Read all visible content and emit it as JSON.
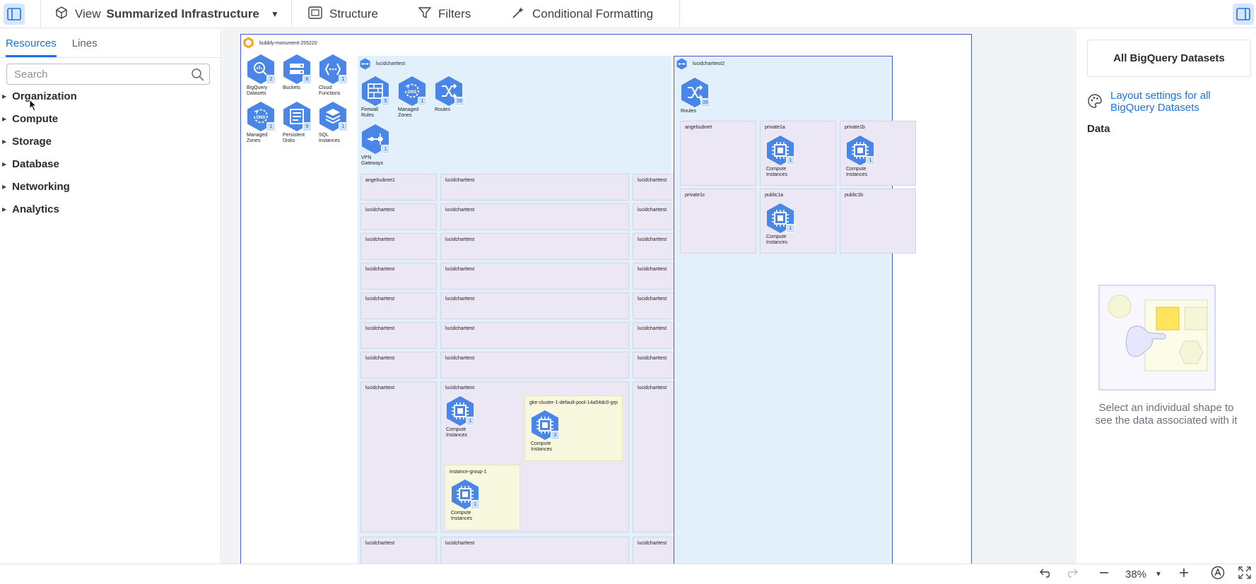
{
  "toolbar": {
    "view_label": "View",
    "view_name": "Summarized Infrastructure",
    "structure_label": "Structure",
    "filters_label": "Filters",
    "conditional_formatting_label": "Conditional Formatting"
  },
  "left_panel": {
    "tabs": [
      "Resources",
      "Lines"
    ],
    "search_placeholder": "Search",
    "categories": [
      "Organization",
      "Compute",
      "Storage",
      "Database",
      "Networking",
      "Analytics"
    ]
  },
  "diagram": {
    "project_name": "bubbly-monument-255220",
    "project_resources": [
      {
        "name": "BigQuery Datasets",
        "line1": "BigQuery",
        "line2": "Datasets",
        "count": "2",
        "icon": "bigquery-icon"
      },
      {
        "name": "Buckets",
        "line1": "Buckets",
        "line2": "",
        "count": "6",
        "icon": "bucket-icon"
      },
      {
        "name": "Cloud Functions",
        "line1": "Cloud",
        "line2": "Functions",
        "count": "1",
        "icon": "cloud-functions-icon"
      },
      {
        "name": "Managed Zones",
        "line1": "Managed",
        "line2": "Zones",
        "count": "1",
        "icon": "dns-icon"
      },
      {
        "name": "Persistent Disks",
        "line1": "Persistent",
        "line2": "Disks",
        "count": "9",
        "icon": "disk-icon"
      },
      {
        "name": "SQL Instances",
        "line1": "SQL",
        "line2": "Instances",
        "count": "1",
        "icon": "sql-icon"
      }
    ],
    "vpc1": {
      "name": "lucidcharttest",
      "resources": [
        {
          "name": "Firewall Rules",
          "line1": "Firewall",
          "line2": "Rules",
          "count": "5",
          "icon": "firewall-icon"
        },
        {
          "name": "Managed Zones",
          "line1": "Managed",
          "line2": "Zones",
          "count": "1",
          "icon": "dns-icon"
        },
        {
          "name": "Routes",
          "line1": "Routes",
          "line2": "",
          "count": "39",
          "icon": "routes-icon"
        },
        {
          "name": "VPN Gateways",
          "line1": "VPN",
          "line2": "Gateways",
          "count": "1",
          "icon": "vpn-icon"
        }
      ],
      "subnet_rows": [
        [
          "angelsubnet1",
          "lucidcharttest",
          "lucidcharttest"
        ],
        [
          "lucidcharttest",
          "lucidcharttest",
          "lucidcharttest"
        ],
        [
          "lucidcharttest",
          "lucidcharttest",
          "lucidcharttest"
        ],
        [
          "lucidcharttest",
          "lucidcharttest",
          "lucidcharttest"
        ],
        [
          "lucidcharttest",
          "lucidcharttest",
          "lucidcharttest"
        ],
        [
          "lucidcharttest",
          "lucidcharttest",
          "lucidcharttest"
        ],
        [
          "lucidcharttest",
          "lucidcharttest",
          "lucidcharttest"
        ],
        [
          "lucidcharttest",
          "lucidcharttest",
          "lucidcharttest"
        ],
        [
          "lucidcharttest",
          "lucidcharttest",
          "lucidcharttest"
        ]
      ],
      "compute_in_subnet": {
        "line1": "Compute",
        "line2": "Instances",
        "count": "1"
      },
      "gke_group": {
        "name": "gke-cluster-1-default-pool-14a54dc0-grp",
        "line1": "Compute",
        "line2": "Instances",
        "count": "3"
      },
      "instance_group": {
        "name": "instance-group-1",
        "line1": "Compute",
        "line2": "Instances",
        "count": "1"
      }
    },
    "vpc2": {
      "name": "lucidcharttest2",
      "routes": {
        "line1": "Routes",
        "line2": "",
        "count": "39"
      },
      "subnets": [
        {
          "name": "angelsubnet",
          "has_compute": false
        },
        {
          "name": "private1a",
          "has_compute": true
        },
        {
          "name": "private1b",
          "has_compute": true
        },
        {
          "name": "private1c",
          "has_compute": false
        },
        {
          "name": "public1a",
          "has_compute": true
        },
        {
          "name": "public1b",
          "has_compute": false
        }
      ],
      "compute": {
        "line1": "Compute",
        "line2": "Instances",
        "count": "1"
      }
    }
  },
  "right_panel": {
    "title": "All BigQuery Datasets",
    "layout_link": "Layout settings for all BigQuery Datasets",
    "data_heading": "Data",
    "empty_text": "Select an individual shape to see the data associated with it"
  },
  "bottom_bar": {
    "zoom": "38%"
  },
  "colors": {
    "accent": "#1a73e8",
    "hex_blue": "#4a86e8",
    "vpc_bg": "#e1f0fa",
    "subnet_bg": "#ece7f5",
    "group_bg": "#f8f8df",
    "page_border": "#4a5bd4"
  }
}
